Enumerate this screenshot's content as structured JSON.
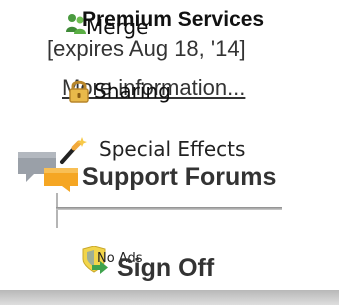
{
  "premium": {
    "title": "Premium Services",
    "expires": "[expires Aug 18, '14]",
    "more_info": "More information..."
  },
  "features": {
    "merge": "Merge",
    "sharing": "Sharing",
    "special_effects": "Special Effects",
    "no_ads": "No Ads"
  },
  "links": {
    "support_forums": "Support Forums",
    "sign_off": "Sign Off"
  },
  "icons": {
    "merge": "merge-people-icon",
    "sharing": "lock-icon",
    "special_effects": "magic-wand-icon",
    "support_forums": "chat-bubbles-icon",
    "no_ads": "shield-arrow-icon"
  },
  "colors": {
    "text": "#333333",
    "chat_grey": "#9aa0a8",
    "chat_orange": "#f5a623",
    "lock_gold": "#e8b94a",
    "wand_orange": "#f2a93b",
    "shield_yellow": "#f2d54a",
    "shield_blue": "#5b8fd6",
    "arrow_green": "#3fa34d"
  }
}
